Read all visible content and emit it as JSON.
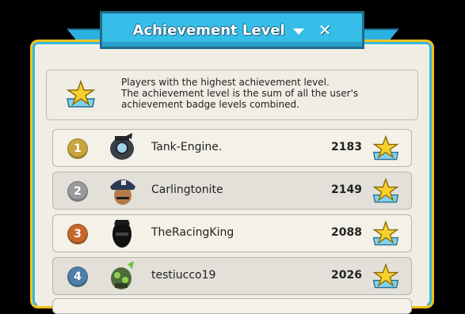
{
  "window": {
    "title": "Achievement Level"
  },
  "info": {
    "lines": [
      "Players with the highest achievement level.",
      "The achievement level is the sum of all the user's",
      "achievement badge levels combined."
    ]
  },
  "colors": {
    "rank1": "#c9a43a",
    "rank2": "#9a9a9a",
    "rank3": "#c6682c",
    "rank4": "#4f7fa8"
  },
  "icons": {
    "badge": "star-badge-icon",
    "dropdown": "chevron-down-icon",
    "close": "close-icon"
  },
  "leaderboard": [
    {
      "rank": "1",
      "name": "Tank-Engine.",
      "score": "2183"
    },
    {
      "rank": "2",
      "name": "Carlingtonite",
      "score": "2149"
    },
    {
      "rank": "3",
      "name": "TheRacingKing",
      "score": "2088"
    },
    {
      "rank": "4",
      "name": "testiucco19",
      "score": "2026"
    }
  ]
}
